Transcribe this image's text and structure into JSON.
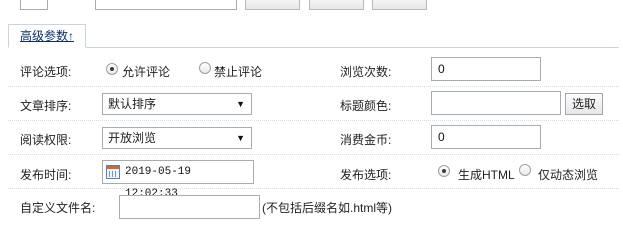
{
  "tab": {
    "label": "高级参数↑"
  },
  "comment": {
    "label": "评论选项:",
    "allow": "允许评论",
    "deny": "禁止评论"
  },
  "views": {
    "label": "浏览次数:",
    "value": "0"
  },
  "sort": {
    "label": "文章排序:",
    "value": "默认排序"
  },
  "title_color": {
    "label": "标题颜色:",
    "value": "",
    "button": "选取"
  },
  "read_perm": {
    "label": "阅读权限:",
    "value": "开放浏览"
  },
  "cost": {
    "label": "消费金币:",
    "value": "0"
  },
  "publish_time": {
    "label": "发布时间:",
    "value": "2019-05-19 12:02:33"
  },
  "publish_opt": {
    "label": "发布选项:",
    "html": "生成HTML",
    "dynamic": "仅动态浏览"
  },
  "custom_file": {
    "label": "自定义文件名:",
    "value": "",
    "hint": "(不包括后缀名如.html等)"
  }
}
